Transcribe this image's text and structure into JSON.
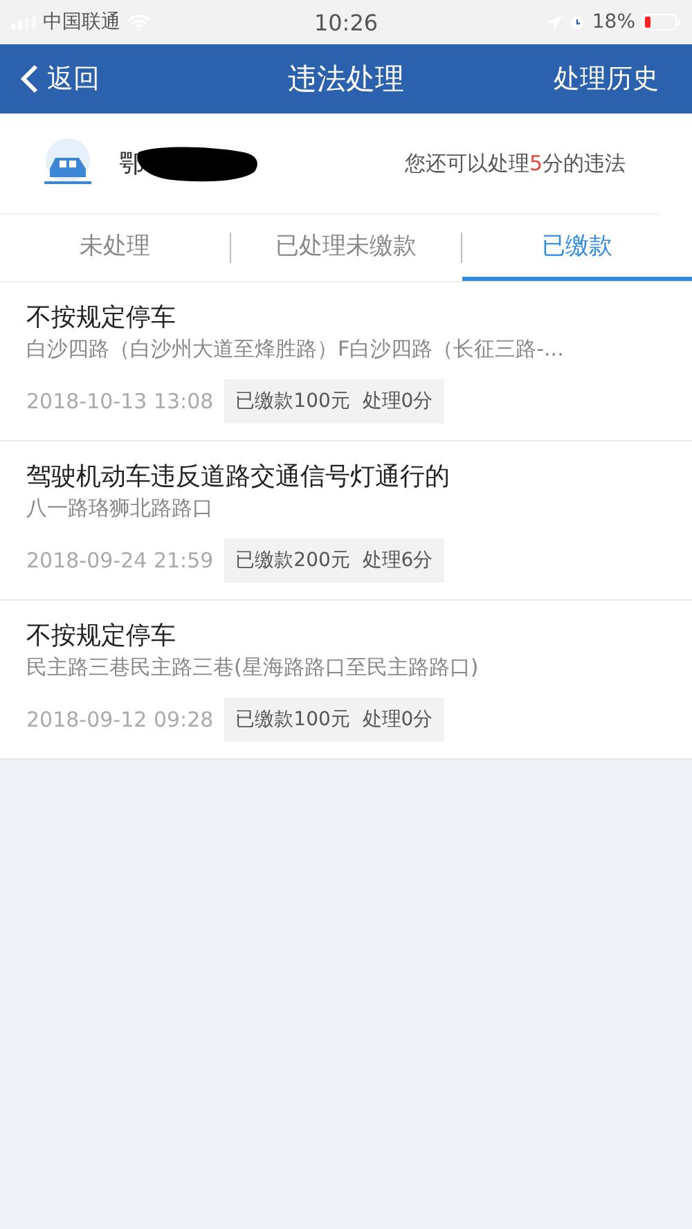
{
  "status_bar": {
    "carrier": "中国联通",
    "time": "10:26",
    "battery": "18%"
  },
  "nav": {
    "back": "返回",
    "title": "违法处理",
    "action": "处理历史"
  },
  "vehicle": {
    "plate": "鄂",
    "notice_prefix": "您还可以处理",
    "notice_points": "5",
    "notice_suffix": "分的违法"
  },
  "tabs": [
    {
      "label": "未处理",
      "selected": false
    },
    {
      "label": "已处理未缴款",
      "selected": false
    },
    {
      "label": "已缴款",
      "selected": true
    }
  ],
  "violations": [
    {
      "title": "不按规定停车",
      "location": "白沙四路（白沙州大道至烽胜路）F白沙四路（长征三路-...",
      "time": "2018-10-13 13:08",
      "status": "已缴款100元  处理0分"
    },
    {
      "title": "驾驶机动车违反道路交通信号灯通行的",
      "location": "八一路珞狮北路路口",
      "time": "2018-09-24 21:59",
      "status": "已缴款200元  处理6分"
    },
    {
      "title": "不按规定停车",
      "location": "民主路三巷民主路三巷(星海路路口至民主路路口)",
      "time": "2018-09-12 09:28",
      "status": "已缴款100元  处理0分"
    }
  ]
}
